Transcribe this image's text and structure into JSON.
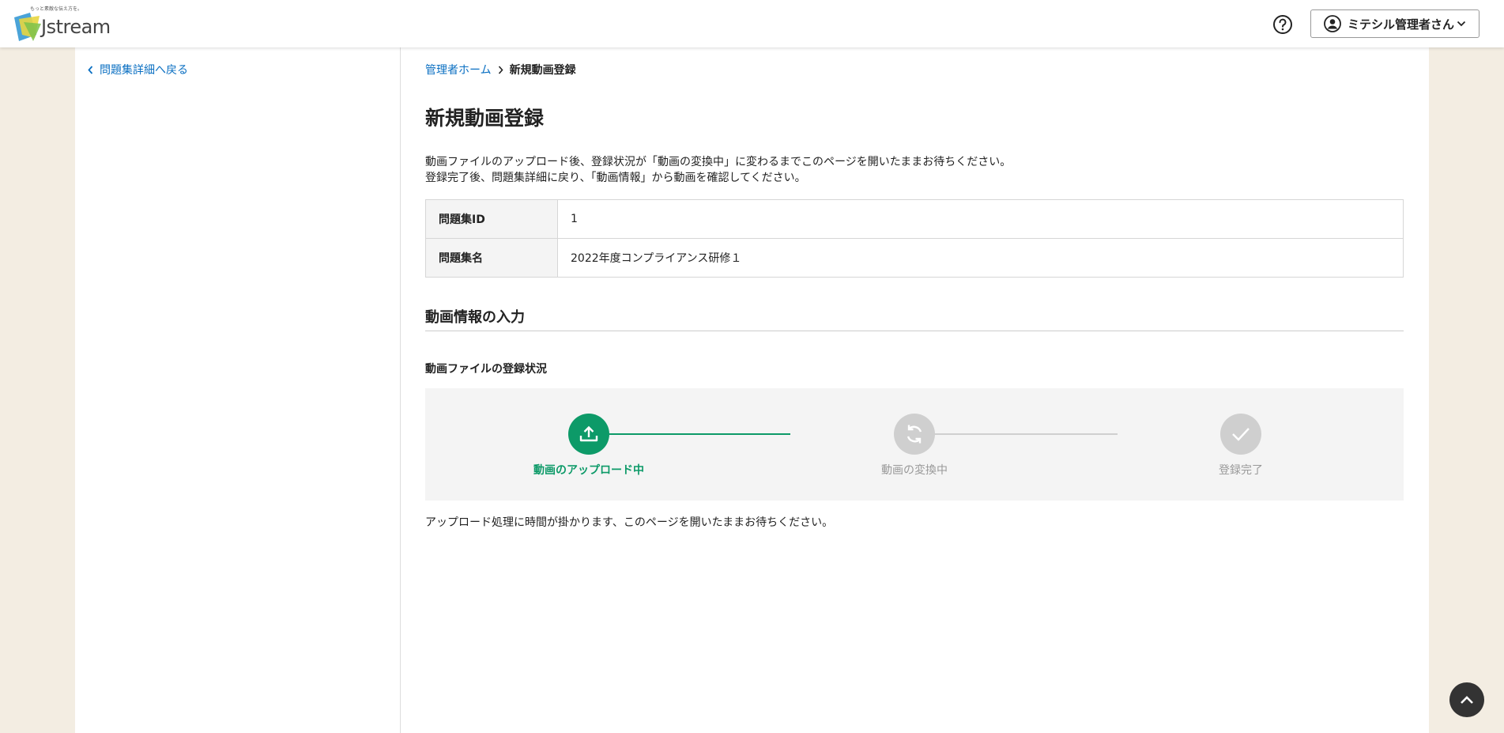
{
  "header": {
    "logo_tagline": "もっと素敵な伝え方を。",
    "logo_text": "Jstream",
    "user_name": "ミテシル管理者さん",
    "icons": {
      "help": "help-circle-icon",
      "user": "user-circle-icon",
      "dropdown": "chevron-down-icon"
    }
  },
  "sidebar": {
    "back_label": "問題集詳細へ戻る"
  },
  "breadcrumb": {
    "home": "管理者ホーム",
    "current": "新規動画登録"
  },
  "page_title": "新規動画登録",
  "description": [
    "動画ファイルのアップロード後、登録状況が「動画の変換中」に変わるまでこのページを開いたままお待ちください。",
    "登録完了後、問題集詳細に戻り、「動画情報」から動画を確認してください。"
  ],
  "info_table": [
    {
      "label": "問題集ID",
      "value": "1"
    },
    {
      "label": "問題集名",
      "value": "2022年度コンプライアンス研修１"
    }
  ],
  "section_title": "動画情報の入力",
  "upload_status": {
    "title": "動画ファイルの登録状況",
    "steps": [
      {
        "label": "動画のアップロード中",
        "icon": "upload-icon",
        "state": "active"
      },
      {
        "label": "動画の変換中",
        "icon": "refresh-icon",
        "state": "inactive"
      },
      {
        "label": "登録完了",
        "icon": "check-icon",
        "state": "inactive"
      }
    ],
    "note": "アップロード処理に時間が掛かります、このページを開いたままお待ちください。"
  },
  "colors": {
    "accent_green": "#0d9a68",
    "inactive_gray": "#cfcfcf",
    "link_blue": "#0a6fc2",
    "background": "#f3ede2"
  }
}
